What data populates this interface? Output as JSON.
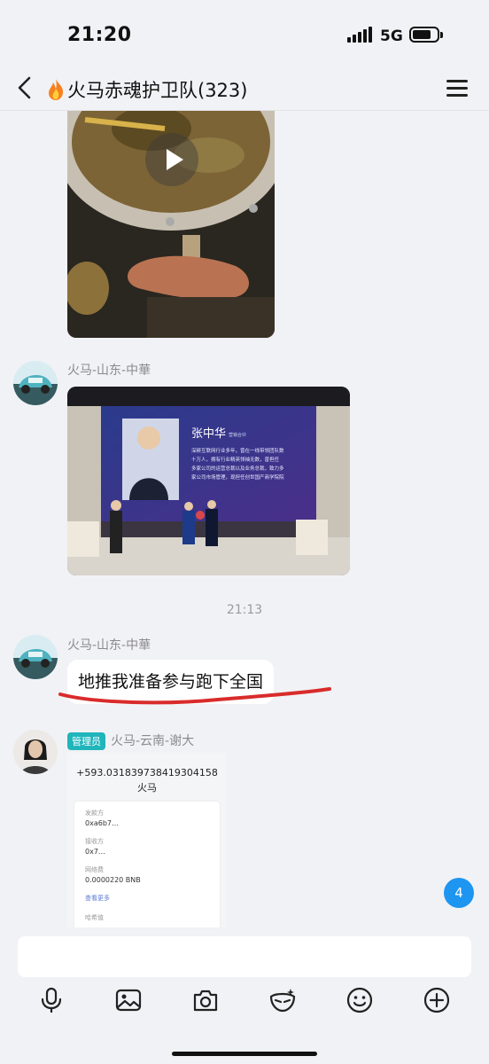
{
  "status_bar": {
    "time": "21:20",
    "network": "5G"
  },
  "header": {
    "title": "火马赤魂护卫队(323)"
  },
  "messages": [
    {
      "type": "video",
      "thumbnail": "hot pot video thumbnail"
    },
    {
      "type": "image",
      "sender": "火马-山东-中華",
      "photo": {
        "name": "张中华",
        "title": "营销合伙",
        "bio": [
          "深耕互联网行业多年，曾在一线带领团队数",
          "十万人，拥有行业精英领袖无数，曾担任",
          "多家公司的运营总裁以及业务总裁，致力多",
          "家公司市场管理，现担任创世国产商学院院"
        ]
      }
    },
    {
      "type": "time",
      "text": "21:13"
    },
    {
      "type": "text",
      "sender": "火马-山东-中華",
      "text": "地推我准备参与跑下全国"
    },
    {
      "type": "image",
      "sender": "火马-云南-谢大",
      "badge": "管理员",
      "screenshot": {
        "address": "+593.031839738419304158",
        "label": "火马",
        "rows": [
          "发款方",
          "0xa6b7…",
          "接收方",
          "0x7…",
          "网络费",
          "0.0000220 BNB",
          "查看更多",
          "哈希值"
        ]
      }
    }
  ],
  "unread_count": "4",
  "toolbar": {
    "icons": [
      "microphone-icon",
      "image-icon",
      "camera-icon",
      "mask-icon",
      "emoji-icon",
      "plus-icon"
    ]
  }
}
